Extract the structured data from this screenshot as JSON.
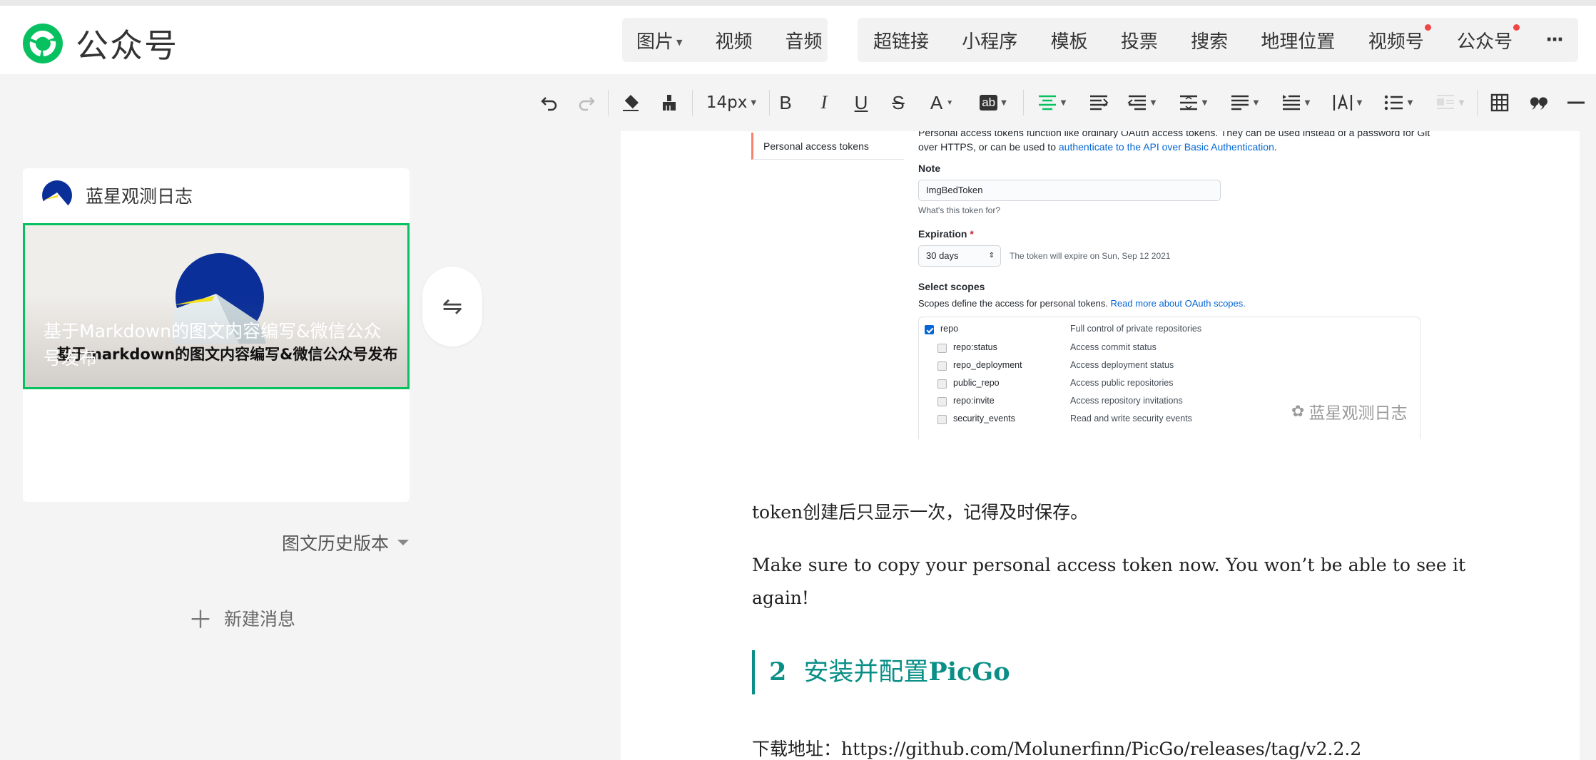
{
  "topnav": {
    "logo_label": "公众号",
    "group1": [
      {
        "label": "图片",
        "caret": true
      },
      {
        "label": "视频"
      },
      {
        "label": "音频"
      }
    ],
    "group2": [
      {
        "label": "超链接"
      },
      {
        "label": "小程序"
      },
      {
        "label": "模板"
      },
      {
        "label": "投票"
      },
      {
        "label": "搜索"
      },
      {
        "label": "地理位置"
      },
      {
        "label": "视频号",
        "dot": true
      },
      {
        "label": "公众号",
        "dot": true
      },
      {
        "label": "···"
      }
    ],
    "accent": "#07c160",
    "badge_color": "#f04545"
  },
  "toolbar": {
    "font_size": "14px",
    "icons": [
      "undo-icon",
      "redo-icon",
      "clear-format-icon",
      "format-painter-icon",
      "font-size-select",
      "bold-icon",
      "italic-icon",
      "underline-icon",
      "strikethrough-icon",
      "font-color-icon",
      "background-color-icon",
      "align-center-icon",
      "indent-icon",
      "outdent-icon",
      "line-height-icon",
      "paragraph-spacing-icon",
      "text-indent-icon",
      "letter-spacing-icon",
      "unordered-list-icon",
      "float-left-icon",
      "table-icon",
      "quote-icon",
      "divider-icon"
    ],
    "labels": {
      "bold": "B",
      "italic": "I",
      "underline": "U",
      "strike": "S",
      "color": "A",
      "bg": "ab"
    }
  },
  "sidebar": {
    "account_name": "蓝星观测日志",
    "cover_title": "基于Markdown的图文内容编写&微信公众号发布",
    "cover_subtext": "基于markdown的图文内容编写&微信公众号发布",
    "new_message": "新建消息",
    "history": "图文历史版本"
  },
  "screenshot": {
    "sidetab": "Personal access tokens",
    "desc_1": "Personal access tokens function like ordinary OAuth access tokens. They can be used instead of a password for Git over HTTPS, or can be used to ",
    "desc_link": "authenticate to the API over Basic Authentication",
    "desc_end": ".",
    "note_label": "Note",
    "note_value": "ImgBedToken",
    "note_help": "What's this token for?",
    "expiration_label": "Expiration",
    "expiration_required": "*",
    "expiration_value": "30 days",
    "expiration_help": "The token will expire on Sun, Sep 12 2021",
    "scopes_label": "Select scopes",
    "scopes_help": "Scopes define the access for personal tokens. ",
    "scopes_link": "Read more about OAuth scopes.",
    "scopes": [
      {
        "name": "repo",
        "desc": "Full control of private repositories",
        "checked": true
      },
      {
        "name": "repo:status",
        "desc": "Access commit status"
      },
      {
        "name": "repo_deployment",
        "desc": "Access deployment status"
      },
      {
        "name": "public_repo",
        "desc": "Access public repositories"
      },
      {
        "name": "repo:invite",
        "desc": "Access repository invitations"
      },
      {
        "name": "security_events",
        "desc": "Read and write security events"
      }
    ],
    "watermark": "蓝星观测日志"
  },
  "article": {
    "p1": "token创建后只显示一次，记得及时保存。",
    "p2": "Make sure to copy your personal access token now. You won’t be able to see it again!",
    "h2_num": "2",
    "h2_text_cn": "安装并配置",
    "h2_text_en": "PicGo",
    "p3": "下载地址：https://github.com/Molunerfinn/PicGo/releases/tag/v2.2.2",
    "heading_color": "#0a8f87"
  }
}
